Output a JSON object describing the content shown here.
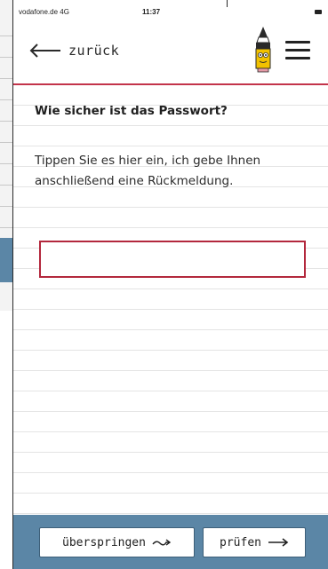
{
  "status_bar": {
    "carrier": "vodafone.de 4G",
    "time": "11:37"
  },
  "nav": {
    "back_label": "zurück",
    "icons": [
      "back-arrow-icon",
      "pencil-mascot-icon",
      "menu-icon"
    ]
  },
  "question": {
    "title": "Wie sicher ist das Passwort?",
    "instruction": "Tippen Sie es hier ein, ich gebe Ihnen anschließend eine Rückmeldung."
  },
  "password_input": {
    "value": "",
    "placeholder": ""
  },
  "actions": {
    "skip_label": "überspringen",
    "check_label": "prüfen"
  },
  "colors": {
    "accent_red": "#c3334a",
    "bar_blue": "#5b86a6"
  }
}
